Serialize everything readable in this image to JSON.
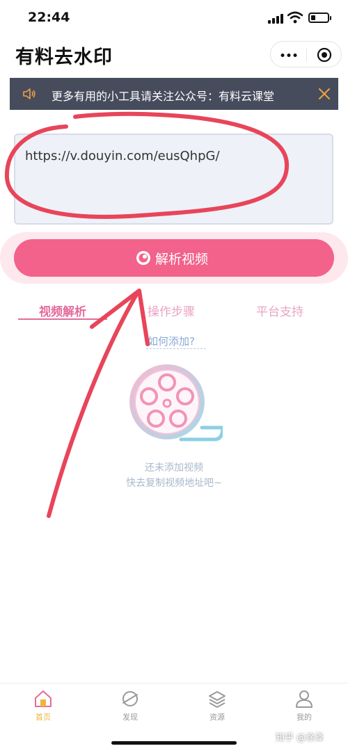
{
  "status_bar": {
    "time": "22:44"
  },
  "header": {
    "title": "有料去水印"
  },
  "notice": {
    "text": "更多有用的小工具请关注公众号：有料云课堂"
  },
  "url_input": {
    "value": "https://v.douyin.com/eusQhpG/"
  },
  "parse_button": {
    "label": "解析视频"
  },
  "tabs": [
    {
      "label": "视频解析"
    },
    {
      "label": "操作步骤"
    },
    {
      "label": "平台支持"
    }
  ],
  "how_link": "如何添加?",
  "empty_state": {
    "line1": "还未添加视频",
    "line2": "快去复制视频地址吧~"
  },
  "tabbar": {
    "items": [
      {
        "label": "首页",
        "icon": "home-icon"
      },
      {
        "label": "发现",
        "icon": "planet-icon"
      },
      {
        "label": "资源",
        "icon": "layers-icon"
      },
      {
        "label": "我的",
        "icon": "user-icon"
      }
    ]
  },
  "watermark": "知乎 @涂泽",
  "colors": {
    "accent": "#f2628a",
    "notice_bg": "#464c5c",
    "tab_active": "#e46b9b",
    "tab_active_icon": "#f0b43c",
    "annotation": "#e8455a"
  }
}
